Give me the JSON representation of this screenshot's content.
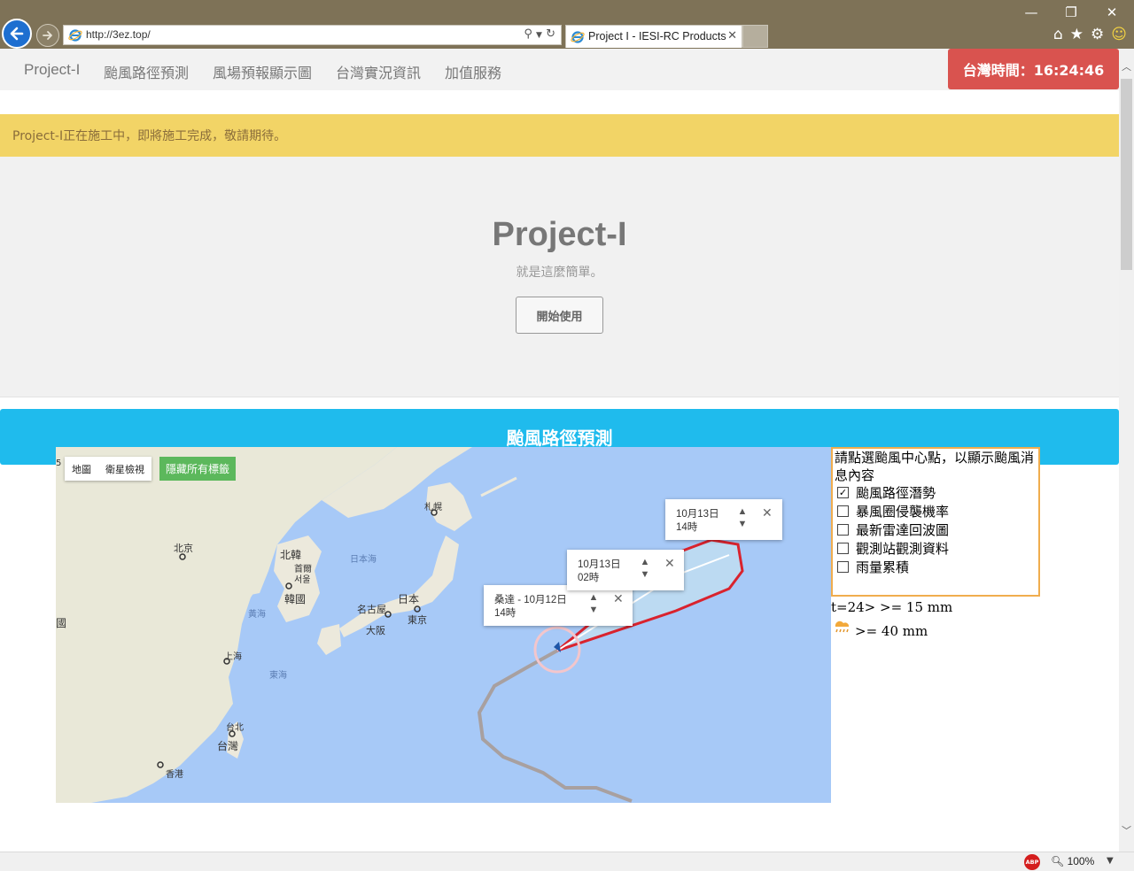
{
  "browser": {
    "url": "http://3ez.top/",
    "tab_title": "Project I - IESI-RC Products",
    "tab_close": "✕",
    "minimize": "—",
    "restore": "❐",
    "close": "✕",
    "zoom_level": "100%",
    "adblock_label": "ABP"
  },
  "navbar": {
    "brand": "Project-I",
    "items": [
      {
        "label": "颱風路徑預測"
      },
      {
        "label": "風場預報顯示圖"
      },
      {
        "label": "台灣實況資訊"
      },
      {
        "label": "加值服務"
      }
    ],
    "clock": "台灣時間：16:24:46"
  },
  "alert": "Project-I正在施工中，即將施工完成，敬請期待。",
  "jumbotron": {
    "title": "Project-I",
    "subtitle": "就是這麼簡單。",
    "button": "開始使用"
  },
  "section_title": "颱風路徑預測",
  "map": {
    "type_map": "地圖",
    "type_satellite": "衛星檢視",
    "hide_labels": "隱藏所有標籤",
    "track_color": "#d9232e",
    "past_track_color": "#a8a0a0",
    "popups": [
      {
        "line1": "桑達 - 10月12日",
        "line2": "14時"
      },
      {
        "line1": "10月13日",
        "line2": "02時"
      },
      {
        "line1": "10月13日",
        "line2": "14時"
      }
    ],
    "places": {
      "beijing": "北京",
      "n_korea": "北韓",
      "pyongyang": "首爾",
      "seoul": "서울",
      "s_korea": "韓國",
      "japan": "日本",
      "nagoya": "名古屋",
      "tokyo": "東京",
      "osaka": "大阪",
      "sapporo": "札幌",
      "shanghai": "上海",
      "taipei": "台北",
      "taiwan": "台灣",
      "hongkong": "香港",
      "country_edge": "國",
      "edge_char": "5"
    },
    "seas": {
      "japan_sea": "日本海",
      "yellow_sea": "黃海",
      "east_sea": "東海"
    }
  },
  "panel": {
    "instruction": "請點選颱風中心點，以顯示颱風消息內容",
    "options": [
      {
        "label": "颱風路徑潛勢",
        "checked": true
      },
      {
        "label": "暴風圈侵襲機率",
        "checked": false
      },
      {
        "label": "最新雷達回波圖",
        "checked": false
      },
      {
        "label": "觀測站觀測資料",
        "checked": false
      },
      {
        "label": "雨量累積",
        "checked": false
      }
    ],
    "legend1": "t=24> >= 15 mm",
    "legend2": ">= 40 mm"
  }
}
